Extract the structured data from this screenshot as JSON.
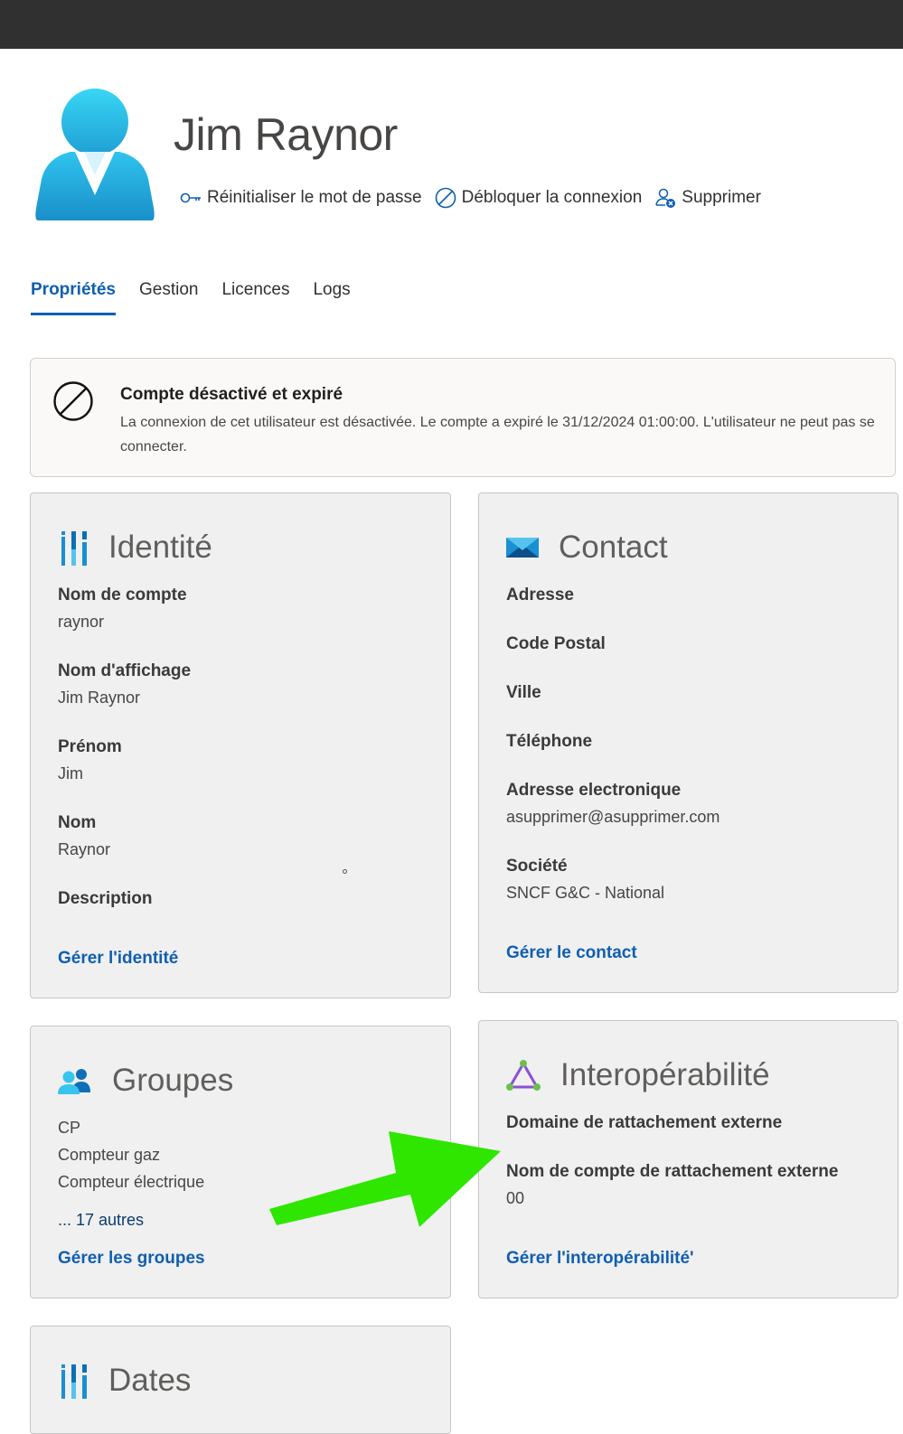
{
  "user": {
    "name": "Jim Raynor"
  },
  "actions": {
    "reset_password": "Réinitialiser le mot de passe",
    "unblock_login": "Débloquer la connexion",
    "delete": "Supprimer"
  },
  "tabs": [
    {
      "label": "Propriétés",
      "active": true
    },
    {
      "label": "Gestion"
    },
    {
      "label": "Licences"
    },
    {
      "label": "Logs"
    }
  ],
  "alert": {
    "title": "Compte désactivé et expiré",
    "message": "La connexion de cet utilisateur est désactivée. Le compte a expiré le 31/12/2024 01:00:00. L'utilisateur ne peut pas se connecter."
  },
  "identity": {
    "title": "Identité",
    "fields": [
      {
        "label": "Nom de compte",
        "value": "raynor"
      },
      {
        "label": "Nom d'affichage",
        "value": "Jim Raynor"
      },
      {
        "label": "Prénom",
        "value": "Jim"
      },
      {
        "label": "Nom",
        "value": "Raynor"
      },
      {
        "label": "Description",
        "value": ""
      }
    ],
    "link": "Gérer l'identité"
  },
  "contact": {
    "title": "Contact",
    "fields": [
      {
        "label": "Adresse",
        "value": ""
      },
      {
        "label": "Code Postal",
        "value": ""
      },
      {
        "label": "Ville",
        "value": ""
      },
      {
        "label": "Téléphone",
        "value": ""
      },
      {
        "label": "Adresse electronique",
        "value": "asupprimer@asupprimer.com"
      },
      {
        "label": "Société",
        "value": "SNCF G&C - National"
      }
    ],
    "link": "Gérer le contact"
  },
  "groups": {
    "title": "Groupes",
    "items": [
      "CP",
      "Compteur gaz",
      "Compteur électrique"
    ],
    "more": "... 17 autres",
    "link": "Gérer les groupes"
  },
  "interop": {
    "title": "Interopérabilité",
    "fields": [
      {
        "label": "Domaine de rattachement externe",
        "value": ""
      },
      {
        "label": "Nom de compte de rattachement externe",
        "value": "00"
      }
    ],
    "link": "Gérer l'interopérabilité'"
  },
  "dates": {
    "title": "Dates"
  },
  "colors": {
    "accent": "#0f5fb0",
    "topbar": "#303030",
    "card_bg": "#f0f0f0",
    "annotation_arrow": "#2ee600"
  },
  "icons": {
    "identity": "bars-icon",
    "contact": "envelope-icon",
    "groups": "users-icon",
    "interop": "triangle-network-icon",
    "dates": "bars-icon"
  }
}
